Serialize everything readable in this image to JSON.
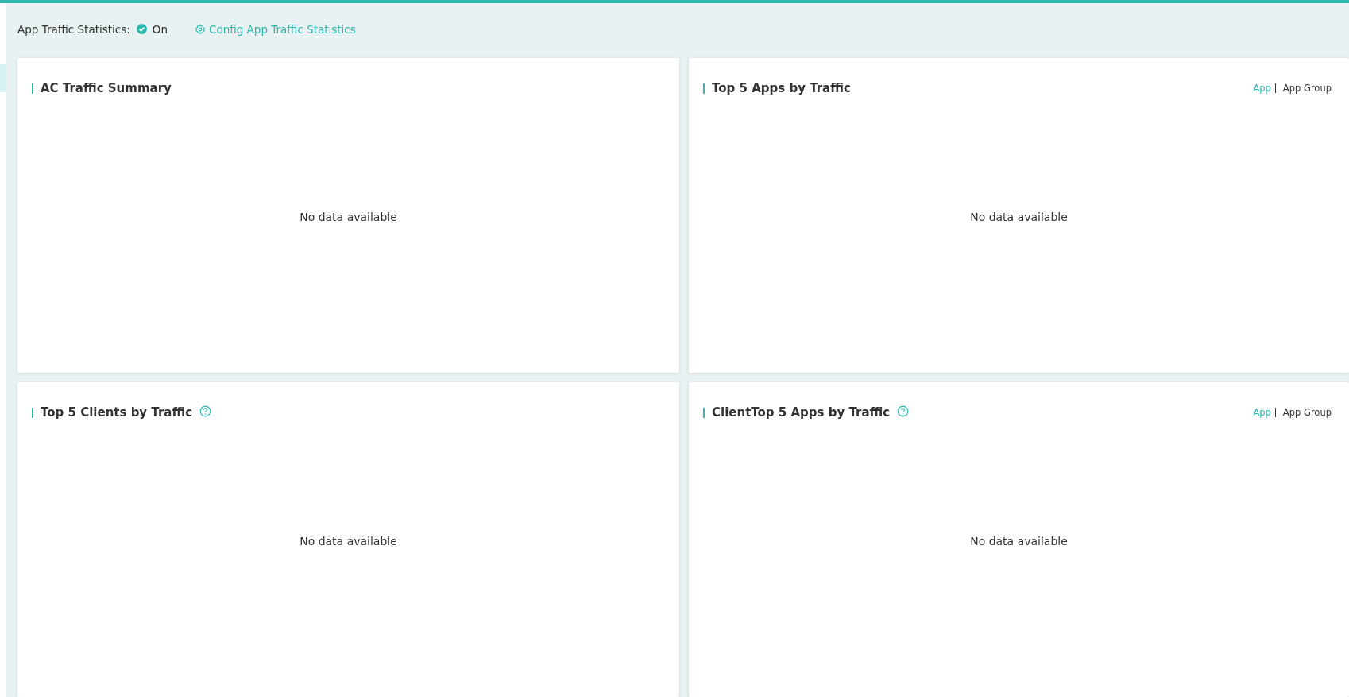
{
  "status": {
    "label": "App Traffic Statistics:",
    "on": true,
    "value": "On",
    "config_link": "Config App Traffic Statistics"
  },
  "panels": [
    {
      "title": "AC Traffic Summary",
      "help": false,
      "empty_text": "No data available"
    },
    {
      "title": "Top 5 Apps by Traffic",
      "help": false,
      "empty_text": "No data available",
      "tabs": [
        {
          "label": "App",
          "selected": true
        },
        {
          "label": "App Group",
          "selected": false
        }
      ]
    },
    {
      "title": "Top 5 Clients by Traffic",
      "help": true,
      "empty_text": "No data available"
    },
    {
      "title": "ClientTop 5 Apps by Traffic",
      "help": true,
      "empty_text": "No data available",
      "tabs": [
        {
          "label": "App",
          "selected": true
        },
        {
          "label": "App Group",
          "selected": false
        }
      ]
    }
  ]
}
